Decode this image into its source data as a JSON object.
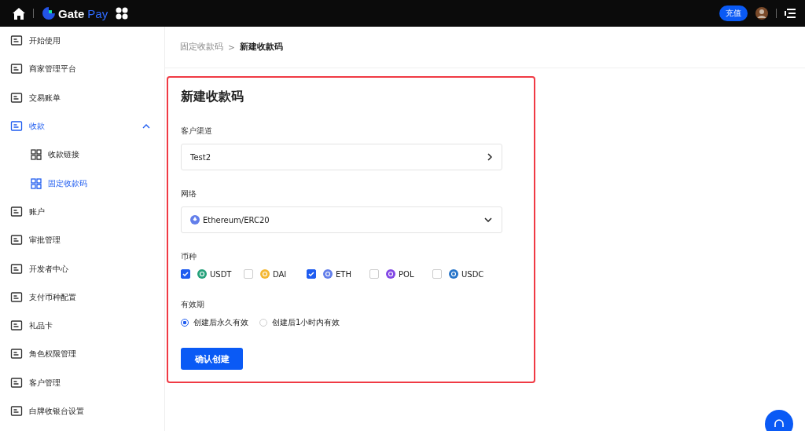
{
  "topbar": {
    "logo_main": "Gate",
    "logo_accent": "Pay",
    "recharge_button": "充值"
  },
  "sidebar": {
    "items": [
      {
        "label": "开始使用",
        "selected": false
      },
      {
        "label": "商家管理平台",
        "selected": false
      },
      {
        "label": "交易账单",
        "selected": false
      },
      {
        "label": "收款",
        "selected": false,
        "expanded": true,
        "children": [
          {
            "label": "收款链接",
            "selected": false
          },
          {
            "label": "固定收款码",
            "selected": true
          }
        ]
      },
      {
        "label": "账户",
        "selected": false
      },
      {
        "label": "审批管理",
        "selected": false
      },
      {
        "label": "开发者中心",
        "selected": false
      },
      {
        "label": "支付币种配置",
        "selected": false
      },
      {
        "label": "礼品卡",
        "selected": false
      },
      {
        "label": "角色权限管理",
        "selected": false
      },
      {
        "label": "客户管理",
        "selected": false
      },
      {
        "label": "白牌收银台设置",
        "selected": false
      }
    ]
  },
  "breadcrumb": {
    "parent": "固定收款码",
    "separator": ">",
    "current": "新建收款码"
  },
  "form": {
    "title": "新建收款码",
    "channel": {
      "label": "客户渠道",
      "value": "Test2"
    },
    "network": {
      "label": "网络",
      "value": "Ethereum/ERC20",
      "color": "#627eea"
    },
    "currency": {
      "label": "币种",
      "options": [
        {
          "label": "USDT",
          "checked": true,
          "color": "#26a17b"
        },
        {
          "label": "DAI",
          "checked": false,
          "color": "#f4b731"
        },
        {
          "label": "ETH",
          "checked": true,
          "color": "#627eea"
        },
        {
          "label": "POL",
          "checked": false,
          "color": "#8247e5"
        },
        {
          "label": "USDC",
          "checked": false,
          "color": "#2775ca"
        }
      ]
    },
    "validity": {
      "label": "有效期",
      "options": [
        {
          "label": "创建后永久有效",
          "selected": true
        },
        {
          "label": "创建后1小时内有效",
          "selected": false
        }
      ]
    },
    "submit": "确认创建"
  }
}
